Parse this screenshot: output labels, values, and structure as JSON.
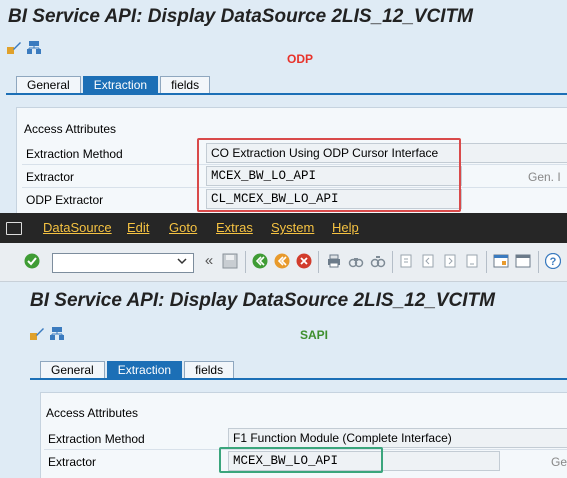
{
  "top": {
    "title": "BI Service API: Display DataSource 2LIS_12_VCITM",
    "annotation": "ODP",
    "tabs": [
      "General",
      "Extraction",
      "fields"
    ],
    "group_title": "Access Attributes",
    "rows": [
      {
        "label": "Extraction Method",
        "value": "CO Extraction Using ODP Cursor Interface"
      },
      {
        "label": "Extractor",
        "value": "MCEX_BW_LO_API"
      },
      {
        "label": "ODP Extractor",
        "value": "CL_MCEX_BW_LO_API"
      }
    ],
    "side_text": "Gen. I"
  },
  "menu": {
    "items": [
      "DataSource",
      "Edit",
      "Goto",
      "Extras",
      "System",
      "Help"
    ]
  },
  "toolbar": {
    "back_chevron": "«"
  },
  "bottom": {
    "title": "BI Service API: Display DataSource 2LIS_12_VCITM",
    "annotation": "SAPI",
    "tabs": [
      "General",
      "Extraction",
      "fields"
    ],
    "group_title": "Access Attributes",
    "rows": [
      {
        "label": "Extraction Method",
        "value": "F1 Function Module (Complete Interface)"
      },
      {
        "label": "Extractor",
        "value": "MCEX_BW_LO_API"
      }
    ],
    "side_text": "Ge"
  },
  "colors": {
    "accent": "#1c6fb6",
    "odp_label": "#e8322a",
    "sapi_label": "#3e8f2d",
    "highlight_red": "#d94a4a",
    "highlight_green": "#3aa57c",
    "menu_text": "#f5c242"
  }
}
